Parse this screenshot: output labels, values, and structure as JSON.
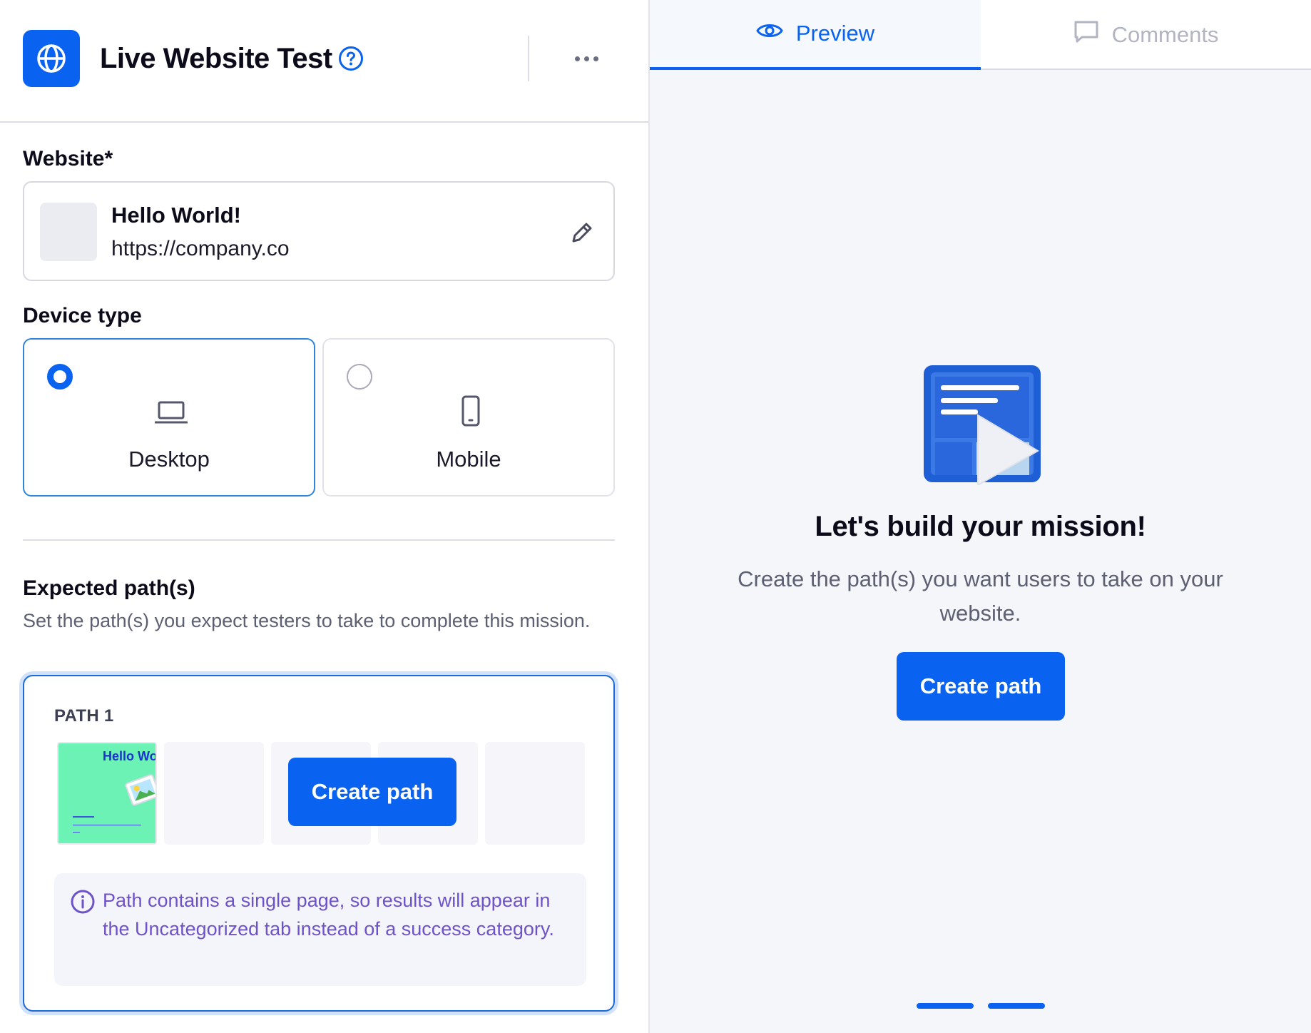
{
  "header": {
    "title": "Live Website Test"
  },
  "website": {
    "label": "Website*",
    "name": "Hello World!",
    "url": "https://company.co"
  },
  "device": {
    "label": "Device type",
    "selected": "Desktop",
    "options": [
      {
        "label": "Desktop"
      },
      {
        "label": "Mobile"
      }
    ]
  },
  "paths": {
    "label": "Expected path(s)",
    "description": "Set the path(s) you expect testers to take to complete this mission.",
    "path1": {
      "title": "PATH 1",
      "thumbnail_title": "Hello Wo",
      "create_label": "Create path",
      "info": "Path contains a single page, so results will appear in the Uncategorized tab instead of a success category."
    }
  },
  "preview": {
    "tabs": [
      {
        "label": "Preview",
        "icon": "eye-icon",
        "active": true
      },
      {
        "label": "Comments",
        "icon": "comment-icon",
        "active": false
      }
    ],
    "empty_title": "Let's build your mission!",
    "empty_subtitle": "Create the path(s) you want users to take on your website.",
    "create_label": "Create path"
  },
  "colors": {
    "primary": "#0a63f0",
    "selected_border": "#2e86d9",
    "info_text": "#6e52c9",
    "right_bg": "#f5f6fa"
  }
}
